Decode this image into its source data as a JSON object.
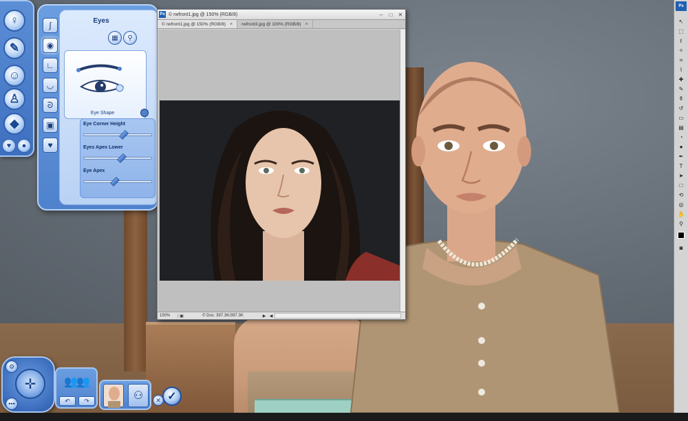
{
  "colors": {
    "cas_blue": "#4f82cd",
    "cas_light": "#dceafd",
    "ps_chrome": "#d6d6d6",
    "ps_canvas": "#bfbfbf"
  },
  "cas": {
    "nav_icons": [
      "gender-icon",
      "hair-icon",
      "face-icon",
      "body-icon",
      "traits-icon"
    ],
    "eyes_panel": {
      "title": "Eyes",
      "view_buttons": [
        "presets-icon",
        "magnify-icon"
      ],
      "part_icons": [
        "nose-icon",
        "eye-icon",
        "jaw-icon",
        "lips-icon",
        "ear-icon",
        "face-mask-icon",
        "heart-icon"
      ],
      "shape_label": "Eye Shape",
      "sliders": [
        {
          "label": "Eye Corner Height",
          "value": 0.55
        },
        {
          "label": "Eyes Apex Lower",
          "value": 0.52
        },
        {
          "label": "Eye Apex",
          "value": 0.42
        }
      ]
    }
  },
  "photoshop": {
    "window_title": "© rwfront1.jpg @ 150% (RGB/8)",
    "tabs": [
      {
        "label": "© rwfront1.jpg @ 150% (RGB/8)",
        "active": true
      },
      {
        "label": "rwfront3.jpg @ 100% (RGB/8)",
        "active": false
      }
    ],
    "status": {
      "zoom": "150%",
      "doc_info": "© Doc: 397.3K/397.3K"
    },
    "logo": "Ps"
  }
}
